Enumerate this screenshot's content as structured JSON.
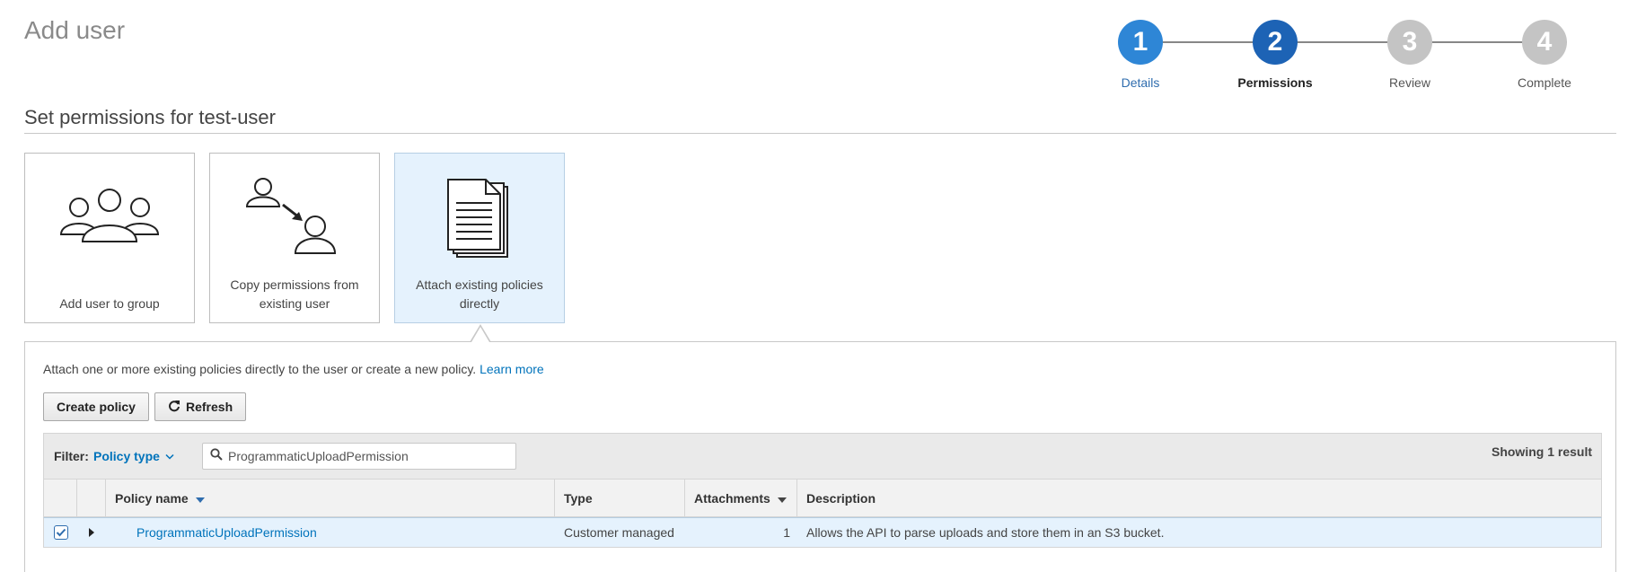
{
  "page": {
    "title": "Add user"
  },
  "stepper": {
    "steps": [
      {
        "number": "1",
        "label": "Details",
        "state": "done",
        "color": "#2e86d6",
        "label_color": "#2f6dae"
      },
      {
        "number": "2",
        "label": "Permissions",
        "state": "current",
        "color": "#1d63b5",
        "label_color": "#222222"
      },
      {
        "number": "3",
        "label": "Review",
        "state": "upcoming",
        "color": "#c4c4c4",
        "label_color": "#555555"
      },
      {
        "number": "4",
        "label": "Complete",
        "state": "upcoming",
        "color": "#c4c4c4",
        "label_color": "#555555"
      }
    ]
  },
  "permissions": {
    "title": "Set permissions for test-user",
    "options": [
      {
        "label": "Add user to group",
        "icon": "group-icon",
        "selected": false
      },
      {
        "label": "Copy permissions from existing user",
        "icon": "copy-user-icon",
        "selected": false
      },
      {
        "label": "Attach existing policies directly",
        "icon": "document-stack-icon",
        "selected": true
      }
    ]
  },
  "panel": {
    "intro": "Attach one or more existing policies directly to the user or create a new policy.",
    "learn_more": "Learn more",
    "buttons": {
      "create_policy": "Create policy",
      "refresh": "Refresh"
    },
    "filter": {
      "label": "Filter:",
      "type_select": "Policy type",
      "search_value": "ProgrammaticUploadPermission",
      "result_count": "Showing 1 result"
    },
    "table": {
      "columns": {
        "name": "Policy name",
        "type": "Type",
        "attachments": "Attachments",
        "description": "Description"
      },
      "rows": [
        {
          "checked": true,
          "name": "ProgrammaticUploadPermission",
          "type": "Customer managed",
          "attachments": "1",
          "description": "Allows the API to parse uploads and store them in an S3 bucket."
        }
      ]
    }
  },
  "colors": {
    "link": "#0073bb",
    "selected_bg": "#e5f2fd"
  }
}
